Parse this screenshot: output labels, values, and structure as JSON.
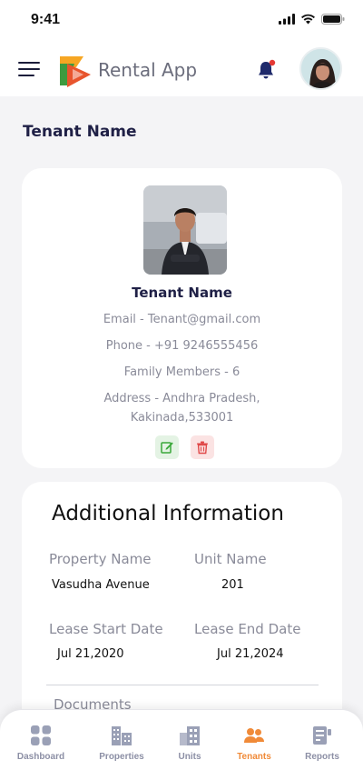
{
  "status_bar": {
    "time": "9:41"
  },
  "header": {
    "app_title": "Rental App"
  },
  "page": {
    "title": "Tenant Name"
  },
  "profile": {
    "name": "Tenant Name",
    "email": "Email - Tenant@gmail.com",
    "phone": "Phone - +91 9246555456",
    "family": "Family Members - 6",
    "address_line1": "Address - Andhra Pradesh,",
    "address_line2": "Kakinada,533001"
  },
  "additional_info": {
    "title": "Additional Information",
    "property_name_label": "Property Name",
    "property_name_value": "Vasudha Avenue",
    "unit_name_label": "Unit Name",
    "unit_name_value": "201",
    "lease_start_label": "Lease Start Date",
    "lease_start_value": "Jul 21,2020",
    "lease_end_label": "Lease End Date",
    "lease_end_value": "Jul 21,2024",
    "documents_label": "Documents"
  },
  "nav": {
    "items": [
      {
        "label": "Dashboard",
        "icon": "dashboard-icon"
      },
      {
        "label": "Properties",
        "icon": "properties-icon"
      },
      {
        "label": "Units",
        "icon": "units-icon"
      },
      {
        "label": "Tenants",
        "icon": "tenants-icon"
      },
      {
        "label": "Reports",
        "icon": "reports-icon"
      }
    ],
    "active": "Tenants"
  },
  "colors": {
    "accent": "#f08a38",
    "primary_text": "#1f2046",
    "muted_text": "#8a8b99",
    "bell": "#1f2a6b",
    "notification_dot": "#e53935"
  }
}
